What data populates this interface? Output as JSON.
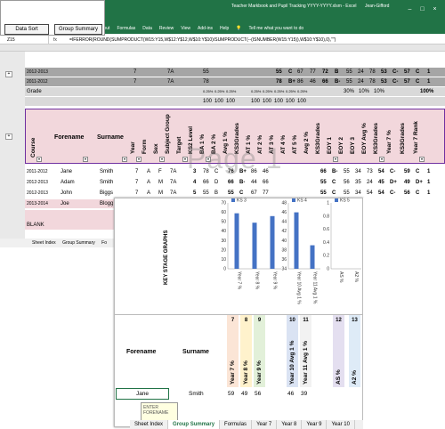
{
  "macros": {
    "data_sort": "Data Sort",
    "group_summary": "Group Summary"
  },
  "window": {
    "title": "Teacher Markbook and Pupil Tracking YYYY-YYYY.xlsm - Excel",
    "user": "Jean-Gifford"
  },
  "ribbon": {
    "tabs": [
      "yout",
      "Formulas",
      "Data",
      "Review",
      "View",
      "Add-ins",
      "Help"
    ],
    "tellme": "Tell me what you want to do"
  },
  "formula_bar": {
    "name_box": "Z15",
    "fx": "fx",
    "formula": "=IFERROR(ROUND(SUMPRODUCT(W15:Y15,W$12:Y$12,W$10:Y$10)/SUMPRODUCT(--(ISNUMBER(W15:Y15)),W$10:Y$10),0),\"\")"
  },
  "top_rows": [
    {
      "label": "2012-2013",
      "c1": "7",
      "c2": "7A",
      "c3": "55",
      "c4": "55",
      "c5": "C",
      "c6": "67",
      "c7": "77",
      "c8": "72",
      "c9": "B",
      "c10": "55",
      "c11": "24",
      "c12": "78",
      "c13": "53",
      "c14": "C-",
      "c15": "57",
      "c16": "C",
      "c17": "1"
    },
    {
      "label": "2011-2012",
      "c1": "7",
      "c2": "7A",
      "c3": "78",
      "c4": "78",
      "c5": "B+",
      "c6": "86",
      "c7": "46",
      "c8": "66",
      "c9": "B-",
      "c10": "55",
      "c11": "24",
      "c12": "78",
      "c13": "53",
      "c14": "C-",
      "c15": "57",
      "c16": "C",
      "c17": "1"
    }
  ],
  "grade_row": {
    "label": "Grade",
    "pcts": [
      "0.25%",
      "0.25%",
      "0.25%",
      "0.25%",
      "0.25%",
      "0.25%",
      "0.25%",
      "0.25%"
    ],
    "r1": "30%",
    "r2": "10%",
    "r3": "10%",
    "total": "100%"
  },
  "hundreds": [
    "100",
    "100",
    "100",
    "100",
    "100",
    "100",
    "100",
    "100"
  ],
  "headers": {
    "course": "Course",
    "forename": "Forename",
    "surname": "Surname",
    "vertical": [
      "Year",
      "Form",
      "Sex",
      "Subject Group",
      "Target",
      "KS2 Level",
      "BA 1 %",
      "BA 2 %",
      "Avg 1 %",
      "KS3Grades",
      "AT 1 %",
      "AT 2 %",
      "AT 3 %",
      "AT 4 %",
      "AT 5 %",
      "Avg 2 %",
      "KS3Grades",
      "EOY 1",
      "EOY 2",
      "EOY 3",
      "EOY Avg %",
      "KS3Grades",
      "Year 7 %",
      "KS3Grades",
      "Year 7 Rank"
    ]
  },
  "students": [
    {
      "course": "2011-2012",
      "forename": "Jane",
      "surname": "Smith",
      "year": "7",
      "form": "A",
      "sex": "F",
      "group": "7A",
      "target": "3",
      "ks2": "78",
      "ba1": "C",
      "avg": "76",
      "grade": "B+",
      "at": "86",
      "at2": "46",
      "avg2": "66",
      "g2": "B-",
      "e1": "55",
      "e2": "34",
      "e3": "73",
      "eavg": "54",
      "g3": "C-",
      "y7": "59",
      "g4": "C",
      "rank": "1"
    },
    {
      "course": "2012-2013",
      "forename": "Adam",
      "surname": "Smith",
      "year": "7",
      "form": "A",
      "sex": "M",
      "group": "7A",
      "target": "4",
      "ks2": "66",
      "ba1": "D",
      "avg": "66",
      "grade": "B-",
      "at": "44",
      "at2": "66",
      "avg2": "55",
      "g2": "C",
      "e1": "56",
      "e2": "35",
      "e3": "24",
      "eavg": "45",
      "g3": "D+",
      "y7": "49",
      "g4": "D+",
      "rank": "1"
    },
    {
      "course": "2012-2013",
      "forename": "John",
      "surname": "Biggs",
      "year": "7",
      "form": "A",
      "sex": "M",
      "group": "7A",
      "target": "5",
      "ks2": "55",
      "ba1": "B",
      "avg": "55",
      "grade": "C",
      "at": "67",
      "at2": "77",
      "avg2": "55",
      "g2": "C",
      "e1": "55",
      "e2": "34",
      "e3": "54",
      "eavg": "54",
      "g3": "C-",
      "y7": "56",
      "g4": "C",
      "rank": "1"
    },
    {
      "course": "2013-2014",
      "forename": "Joe",
      "surname": "Blogg",
      "year": "",
      "form": "",
      "sex": "",
      "group": "",
      "target": "",
      "ks2": "",
      "ba1": "",
      "avg": "",
      "grade": "",
      "at": "",
      "at2": "",
      "avg2": "",
      "g2": "",
      "e1": "",
      "e2": "",
      "e3": "86",
      "eavg": "56",
      "g3": "C",
      "y7": "57",
      "g4": "C",
      "rank": "1"
    }
  ],
  "blank_label": "BLANK",
  "watermark": "Page 1",
  "sheet_tabs_top": [
    "Sheet Index",
    "Group Summary",
    "Fo"
  ],
  "overlay": {
    "chart_section_title": "KEY STAGE GRAPHS",
    "forename_header": "Forename",
    "surname_header": "Surname",
    "col_numbers": [
      "7",
      "8",
      "9",
      "10",
      "11",
      "12",
      "13"
    ],
    "col_headers": [
      "Year 7 %",
      "Year 8 %",
      "Year 9 %",
      "Year 10 Avg 1 %",
      "Year 11 Avg 1 %",
      "AS %",
      "A2 %"
    ],
    "row": {
      "forename": "Jane",
      "surname": "Smith",
      "values": [
        "59",
        "49",
        "56",
        "46",
        "39",
        "",
        ""
      ]
    },
    "tooltip": [
      "ENTER",
      "FORENAME"
    ],
    "sheet_tabs": [
      "Sheet Index",
      "Group Summary",
      "Formulas",
      "Year 7",
      "Year 8",
      "Year 9",
      "Year 10"
    ],
    "active_tab": "Group Summary"
  },
  "chart_data": [
    {
      "type": "bar",
      "title": "",
      "series": [
        {
          "name": "KS 3",
          "values": [
            59,
            49,
            56
          ]
        }
      ],
      "categories": [
        "Year 7 %",
        "Year 8 %",
        "Year 9 %"
      ],
      "ylim": [
        0,
        70
      ],
      "yticks": [
        0,
        10,
        20,
        30,
        40,
        50,
        60,
        70
      ]
    },
    {
      "type": "bar",
      "title": "",
      "series": [
        {
          "name": "KS 4",
          "values": [
            46,
            39
          ]
        }
      ],
      "categories": [
        "Year 10 Avg 1 %",
        "Year 11 Avg 1 %"
      ],
      "ylim": [
        34,
        48
      ],
      "yticks": [
        34,
        36,
        38,
        40,
        42,
        44,
        46,
        48
      ]
    },
    {
      "type": "bar",
      "title": "",
      "series": [
        {
          "name": "KS 5",
          "values": [
            0,
            0
          ]
        }
      ],
      "categories": [
        "AS %",
        "A2 %"
      ],
      "ylim": [
        0,
        1
      ],
      "yticks": [
        0,
        0.2,
        0.4,
        0.6,
        0.8,
        1
      ]
    }
  ],
  "colors": {
    "excel_green": "#217346",
    "bar_blue": "#4472c4",
    "pink": "#f2d7dc",
    "purple_border": "#7030a0"
  }
}
